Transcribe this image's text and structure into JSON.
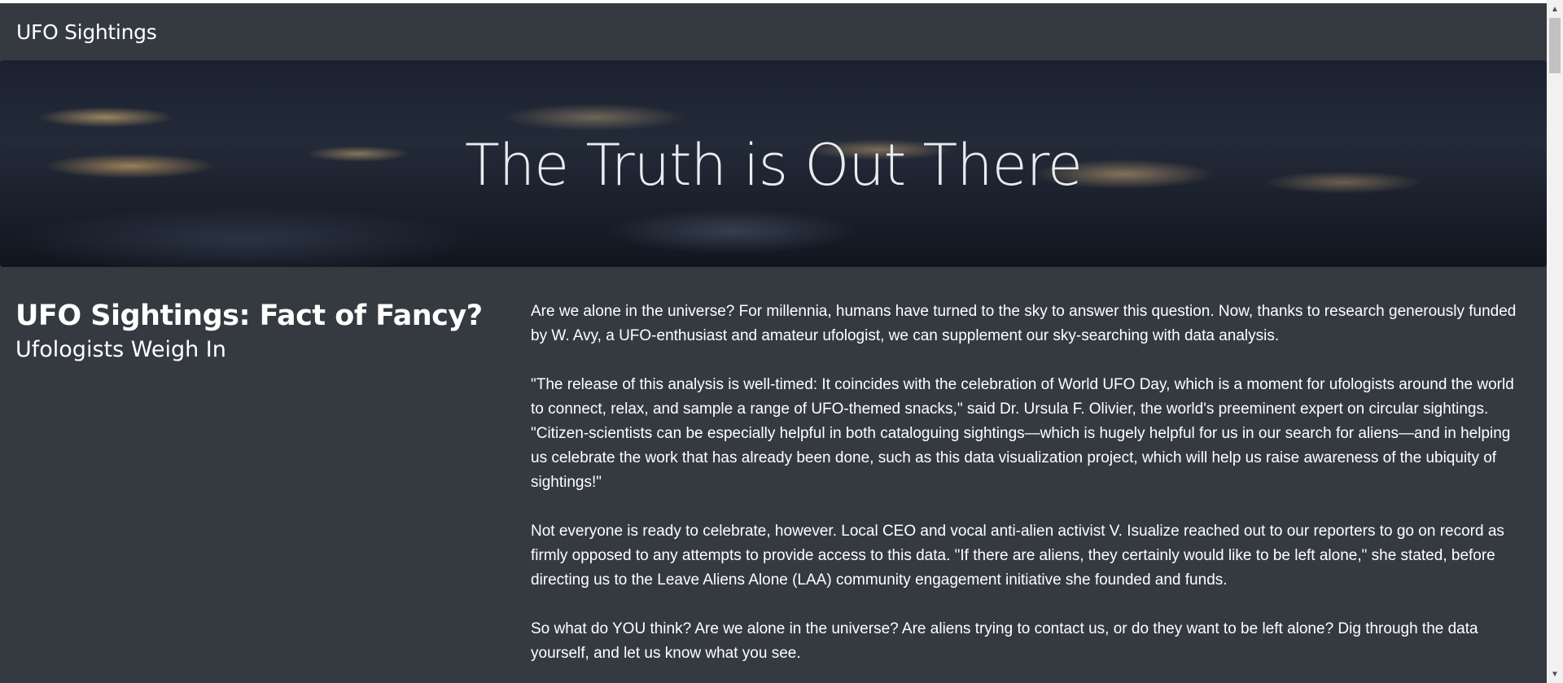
{
  "navbar": {
    "brand": "UFO Sightings"
  },
  "hero": {
    "title": "The Truth is Out There"
  },
  "article": {
    "title": "UFO Sightings: Fact of Fancy?",
    "subtitle": "Ufologists Weigh In",
    "paragraphs": [
      "Are we alone in the universe? For millennia, humans have turned to the sky to answer this question. Now, thanks to research generously funded by W. Avy, a UFO-enthusiast and amateur ufologist, we can supplement our sky-searching with data analysis.",
      "\"The release of this analysis is well-timed: It coincides with the celebration of World UFO Day, which is a moment for ufologists around the world to connect, relax, and sample a range of UFO-themed snacks,\" said Dr. Ursula F. Olivier, the world's preeminent expert on circular sightings. \"Citizen-scientists can be especially helpful in both cataloguing sightings—which is hugely helpful for us in our search for aliens—and in helping us celebrate the work that has already been done, such as this data visualization project, which will help us raise awareness of the ubiquity of sightings!\"",
      "Not everyone is ready to celebrate, however. Local CEO and vocal anti-alien activist V. Isualize reached out to our reporters to go on record as firmly opposed to any attempts to provide access to this data. \"If there are aliens, they certainly would like to be left alone,\" she stated, before directing us to the Leave Aliens Alone (LAA) community engagement initiative she founded and funds.",
      "So what do YOU think? Are we alone in the universe? Are aliens trying to contact us, or do they want to be left alone? Dig through the data yourself, and let us know what you see."
    ]
  },
  "scrollbar": {
    "up_icon": "▲",
    "down_icon": "▼"
  },
  "colors": {
    "background": "#343a40",
    "text": "#ffffff"
  }
}
